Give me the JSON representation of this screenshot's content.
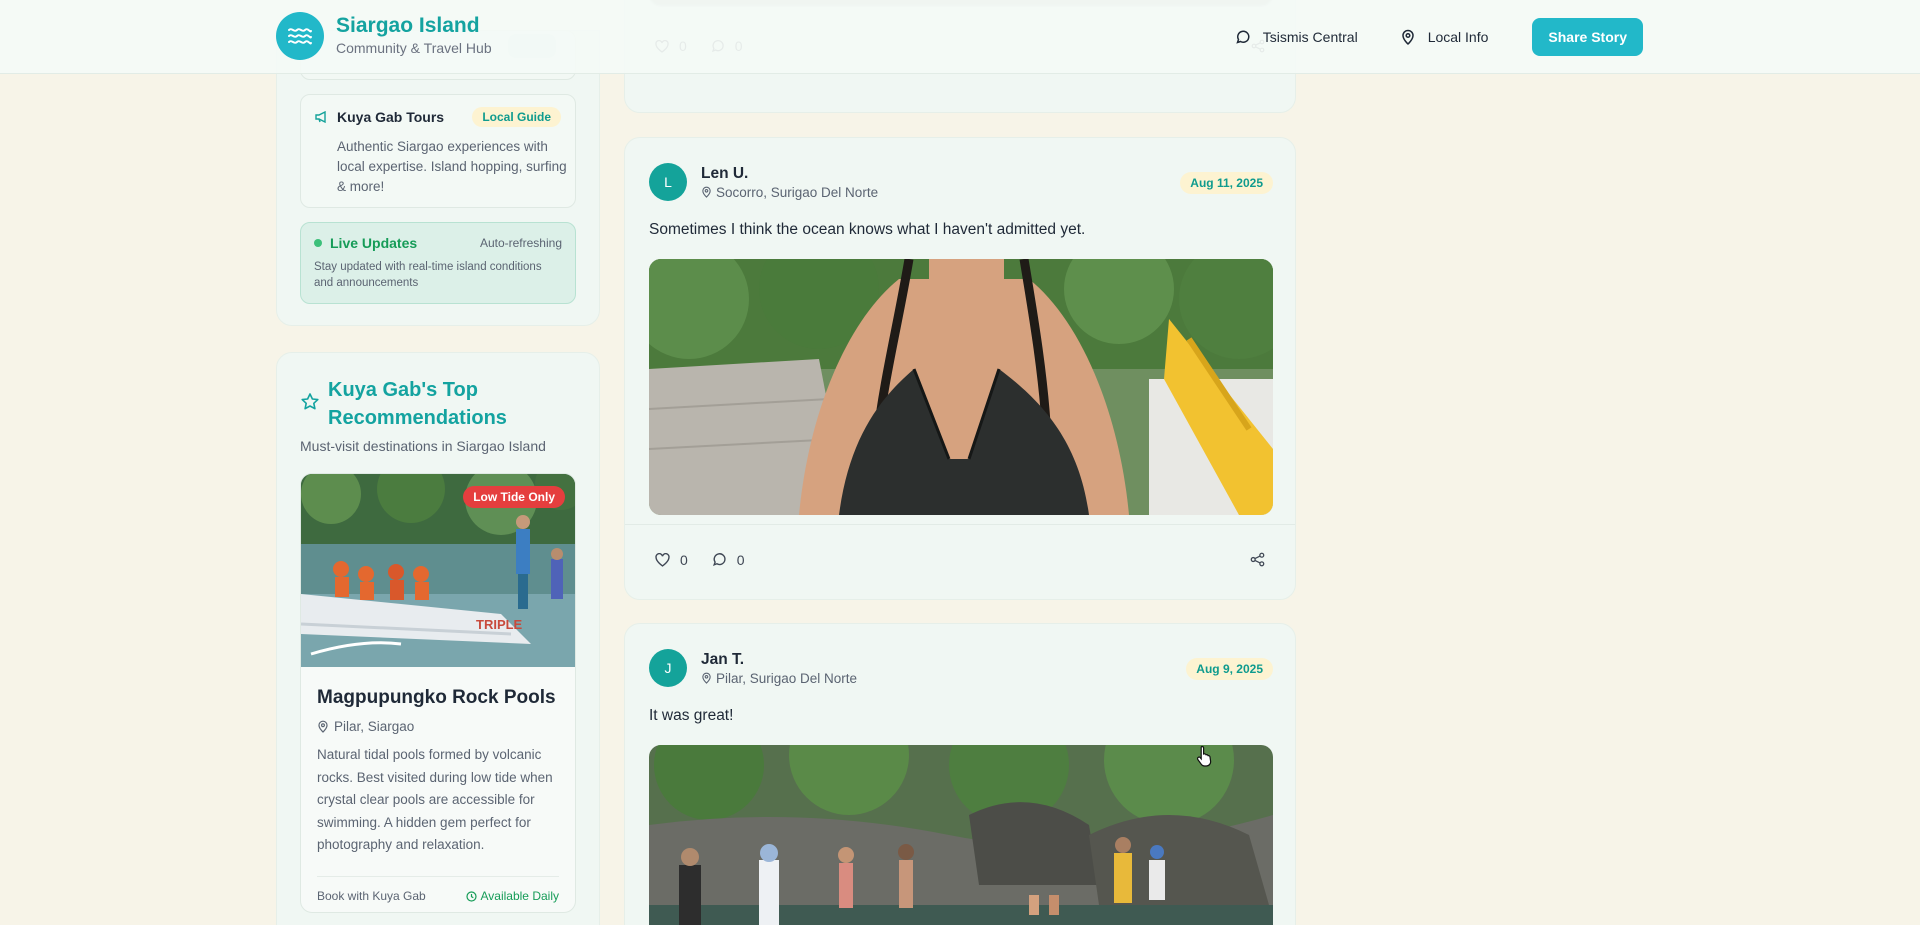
{
  "header": {
    "title": "Siargao Island",
    "subtitle": "Community & Travel Hub",
    "nav": [
      {
        "label": "Tsismis Central",
        "icon": "chat-icon"
      },
      {
        "label": "Local Info",
        "icon": "map-pin-icon"
      }
    ],
    "share_label": "Share Story"
  },
  "sidebar": {
    "tour": {
      "name": "Kuya Gab Tours",
      "badge": "Local Guide",
      "description": "Authentic Siargao experiences with local expertise. Island hopping, surfing & more!"
    },
    "live": {
      "title": "Live Updates",
      "status": "Auto-refreshing",
      "description": "Stay updated with real-time island conditions and announcements"
    },
    "recommendations": {
      "title": "Kuya Gab's Top Recommendations",
      "subtitle": "Must-visit destinations in Siargao Island",
      "place": {
        "badge": "Low Tide Only",
        "boat_text": "TRIPLE",
        "name": "Magpupungko Rock Pools",
        "location": "Pilar, Siargao",
        "description": "Natural tidal pools formed by volcanic rocks. Best visited during low tide when crystal clear pools are accessible for swimming. A hidden gem perfect for photography and relaxation.",
        "book": "Book with Kuya Gab",
        "availability": "Available Daily"
      }
    }
  },
  "feed": {
    "top_post": {
      "likes": "0",
      "comments": "0"
    },
    "posts": [
      {
        "initial": "L",
        "author": "Len U.",
        "location": "Socorro, Surigao Del Norte",
        "date": "Aug 11, 2025",
        "text": "Sometimes I think the ocean knows what I haven't admitted yet.",
        "likes": "0",
        "comments": "0"
      },
      {
        "initial": "J",
        "author": "Jan T.",
        "location": "Pilar, Surigao Del Norte",
        "date": "Aug 9, 2025",
        "text": "It was great!"
      }
    ]
  },
  "colors": {
    "accent": "#22b8c9",
    "brand_text": "#14a3a0",
    "badge_bg": "#fdf3d1",
    "live_green": "#169c58",
    "alert_red": "#e53e3e"
  }
}
